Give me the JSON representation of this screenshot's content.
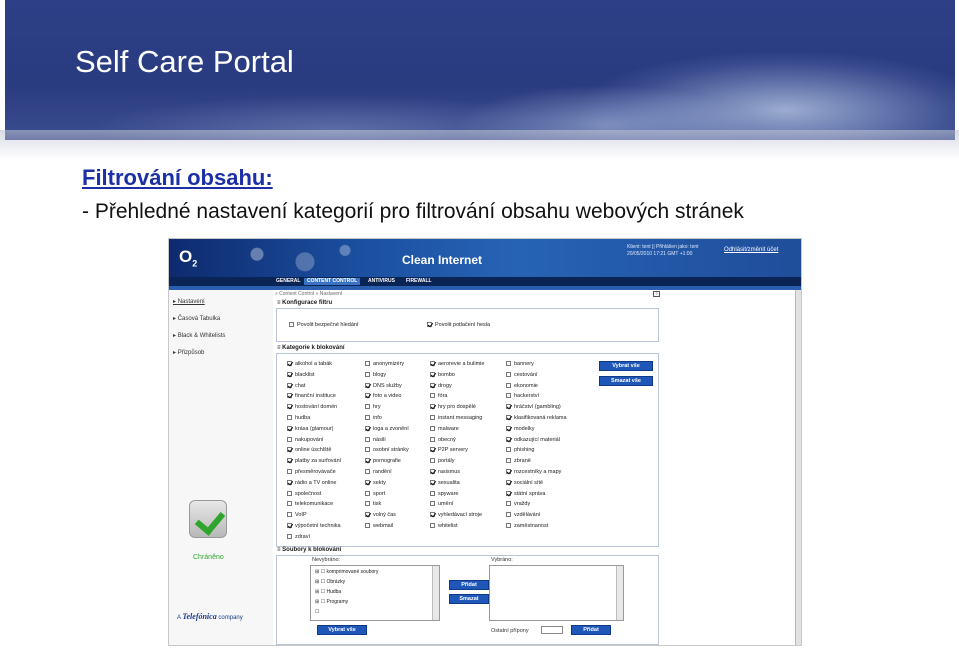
{
  "slide": {
    "title": "Self Care Portal",
    "heading": "Filtrování obsahu:",
    "bullet": "- Přehledné nastavení kategorií pro filtrování obsahu webových stránek"
  },
  "app": {
    "logo": "O",
    "logo_sub": "2",
    "product": "Clean Internet",
    "user_info": "Klient: tent || Přihlášen jako: tent 20/05/2010 17:21 GMT +1:00",
    "logout": "Odhlásit/změnit účet",
    "nav": [
      "GENERAL",
      "CONTENT CONTROL",
      "ANTIVIRUS",
      "FIREWALL"
    ],
    "breadcrumb": "» Content Control » Nastavení"
  },
  "sidebar": {
    "items": [
      "Nastavení",
      "Časová Tabulka",
      "Black & Whitelists",
      "Přizpůsob"
    ],
    "status": "Chráněno",
    "footer_prefix": "A",
    "footer_brand": "Telefónica",
    "footer_suffix": "company"
  },
  "config": {
    "title": "Konfigurace filtru",
    "options": [
      {
        "label": "Povolit bezpečné hledání",
        "checked": false
      },
      {
        "label": "Povolit potlačení hesla",
        "checked": true
      }
    ]
  },
  "categories": {
    "title": "Kategorie k blokování",
    "select_all": "Vybrat vše",
    "clear_all": "Smazat vše",
    "columns": [
      [
        {
          "label": "alkohol a tabák",
          "checked": true
        },
        {
          "label": "blacklist",
          "checked": true
        },
        {
          "label": "chat",
          "checked": true
        },
        {
          "label": "finanční instituce",
          "checked": true
        },
        {
          "label": "hostování domén",
          "checked": true
        },
        {
          "label": "hudba",
          "checked": false
        },
        {
          "label": "krása (glamour)",
          "checked": true
        },
        {
          "label": "nakupování",
          "checked": false
        },
        {
          "label": "online úschlště",
          "checked": true
        },
        {
          "label": "platby za surfování",
          "checked": true
        },
        {
          "label": "přesměrovávače",
          "checked": false
        },
        {
          "label": "rádio a TV online",
          "checked": true
        },
        {
          "label": "společnost",
          "checked": false
        },
        {
          "label": "telekomunikace",
          "checked": false
        },
        {
          "label": "VoIP",
          "checked": false
        },
        {
          "label": "výpočetní technika",
          "checked": true
        },
        {
          "label": "zdraví",
          "checked": false
        }
      ],
      [
        {
          "label": "anonymizéry",
          "checked": false
        },
        {
          "label": "blogy",
          "checked": false
        },
        {
          "label": "DNS služby",
          "checked": true
        },
        {
          "label": "foto a video",
          "checked": true
        },
        {
          "label": "hry",
          "checked": false
        },
        {
          "label": "info",
          "checked": false
        },
        {
          "label": "loga a zvonění",
          "checked": true
        },
        {
          "label": "násilí",
          "checked": false
        },
        {
          "label": "osobní stránky",
          "checked": false
        },
        {
          "label": "pornografie",
          "checked": true
        },
        {
          "label": "randění",
          "checked": false
        },
        {
          "label": "sekty",
          "checked": true
        },
        {
          "label": "sport",
          "checked": false
        },
        {
          "label": "tisk",
          "checked": false
        },
        {
          "label": "volný čas",
          "checked": true
        },
        {
          "label": "webmail",
          "checked": false
        }
      ],
      [
        {
          "label": "aerorevie a bulimie",
          "checked": true
        },
        {
          "label": "bombo",
          "checked": true
        },
        {
          "label": "drogy",
          "checked": true
        },
        {
          "label": "fóra",
          "checked": false
        },
        {
          "label": "hry pro dospělé",
          "checked": true
        },
        {
          "label": "instant messaging",
          "checked": false
        },
        {
          "label": "malware",
          "checked": false
        },
        {
          "label": "obecný",
          "checked": false
        },
        {
          "label": "P2P servery",
          "checked": true
        },
        {
          "label": "portály",
          "checked": false
        },
        {
          "label": "rasismus",
          "checked": true
        },
        {
          "label": "sexualita",
          "checked": true
        },
        {
          "label": "spyware",
          "checked": false
        },
        {
          "label": "umění",
          "checked": false
        },
        {
          "label": "vyhledávací stroje",
          "checked": true
        },
        {
          "label": "whitelist",
          "checked": false
        }
      ],
      [
        {
          "label": "bannery",
          "checked": false
        },
        {
          "label": "cestování",
          "checked": false
        },
        {
          "label": "ekonomie",
          "checked": false
        },
        {
          "label": "hackerství",
          "checked": false
        },
        {
          "label": "hráčství (gambling)",
          "checked": true
        },
        {
          "label": "klasifikovaná reklama",
          "checked": true
        },
        {
          "label": "modelky",
          "checked": true
        },
        {
          "label": "odkazující materiál",
          "checked": true
        },
        {
          "label": "phishing",
          "checked": false
        },
        {
          "label": "zbraně",
          "checked": false
        },
        {
          "label": "rozcestníky a mapy",
          "checked": true
        },
        {
          "label": "sociální sítě",
          "checked": true
        },
        {
          "label": "státní správa",
          "checked": true
        },
        {
          "label": "vraždy",
          "checked": false
        },
        {
          "label": "vzdělávání",
          "checked": false
        },
        {
          "label": "zaměstnanost",
          "checked": false
        }
      ]
    ]
  },
  "files": {
    "title": "Soubory k blokování",
    "unblocked_label": "Nevybráno:",
    "blocked_label": "Vybráno:",
    "items": [
      "komprimované soubory",
      "Obrázky",
      "Hudba",
      "Programy"
    ],
    "add": "Přidat",
    "remove": "Smazat",
    "select_all": "Vybrat vše",
    "other_label": "Ostatní přípony",
    "other_add": "Přidat"
  }
}
